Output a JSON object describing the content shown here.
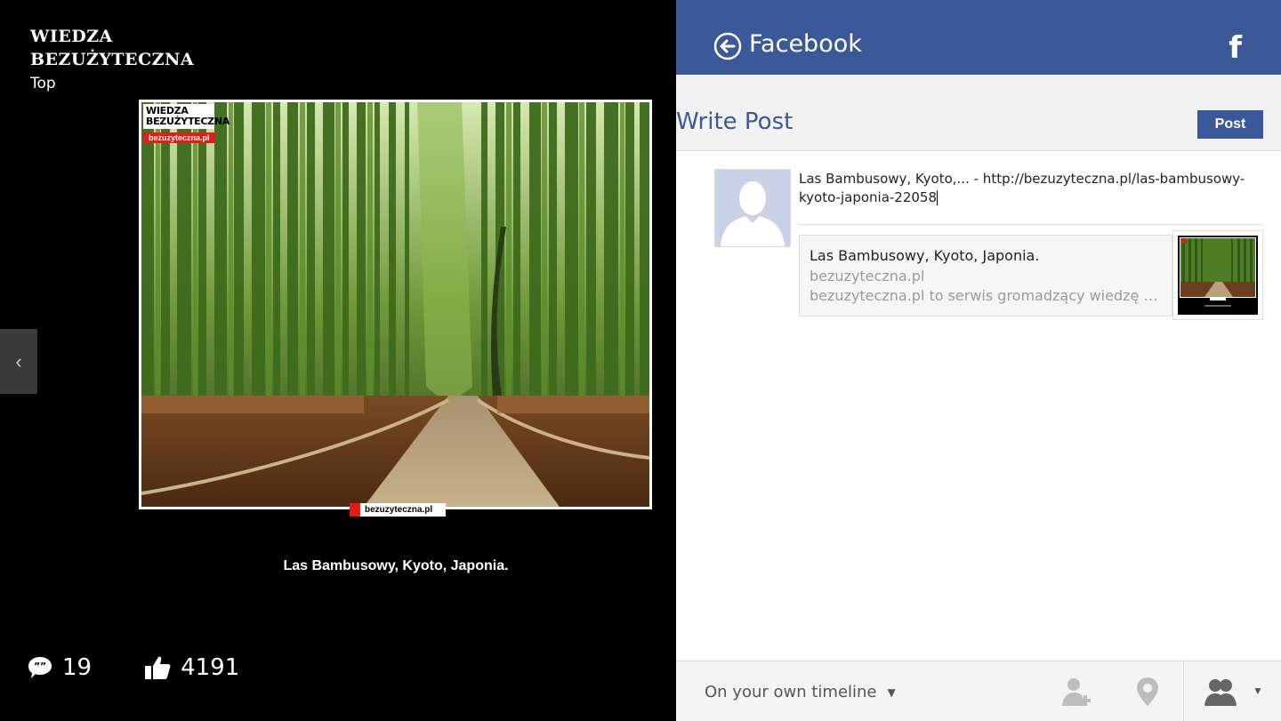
{
  "left": {
    "logo_line1": "WIEDZA",
    "logo_line2": "BEZUŻYTECZNA",
    "section": "Top",
    "watermark_name_1": "WIEDZA",
    "watermark_name_2": "BEZUŻYTECZNA",
    "watermark_url": "bezuzyteczna.pl",
    "watermark_bottom": "bezuzyteczna.pl",
    "caption": "Las Bambusowy, Kyoto, Japonia.",
    "comments_count": "19",
    "likes_count": "4191"
  },
  "facebook": {
    "title": "Facebook",
    "logo": "f",
    "write_post": "Write Post",
    "post_button": "Post",
    "post_text": "Las Bambusowy, Kyoto,... - http://bezuzyteczna.pl/las-bambusowy-kyoto-japonia-22058",
    "link_title": "Las Bambusowy, Kyoto, Japonia.",
    "link_domain": "bezuzyteczna.pl",
    "link_description": "bezuzyteczna.pl to serwis gromadzący wiedzę bezu...",
    "audience": "On your own timeline"
  },
  "colors": {
    "facebook_blue": "#3b5998",
    "background_left": "#000000",
    "watermark_red": "#e41b17"
  }
}
